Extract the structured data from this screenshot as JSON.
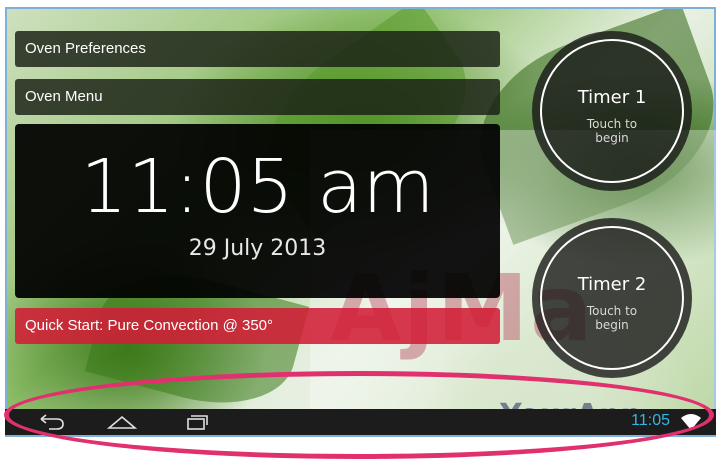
{
  "menu": {
    "preferences_label": "Oven Preferences",
    "menu_label": "Oven Menu"
  },
  "clock": {
    "time": "11:05 am",
    "date": "29 July 2013"
  },
  "quick_start": {
    "label": "Quick Start: Pure Convection @ 350°"
  },
  "timers": [
    {
      "title": "Timer 1",
      "subtitle": "Touch to begin"
    },
    {
      "title": "Timer 2",
      "subtitle": "Touch to begin"
    }
  ],
  "system_bar": {
    "time": "11:05",
    "icons": [
      "back-icon",
      "home-icon",
      "recent-apps-icon",
      "wifi-icon"
    ]
  },
  "watermark": {
    "main": "AjMa",
    "sub": "YourApp"
  },
  "colors": {
    "quick_start": "#d21e37",
    "status_time": "#33b5e5",
    "annotation": "#e0306e"
  }
}
